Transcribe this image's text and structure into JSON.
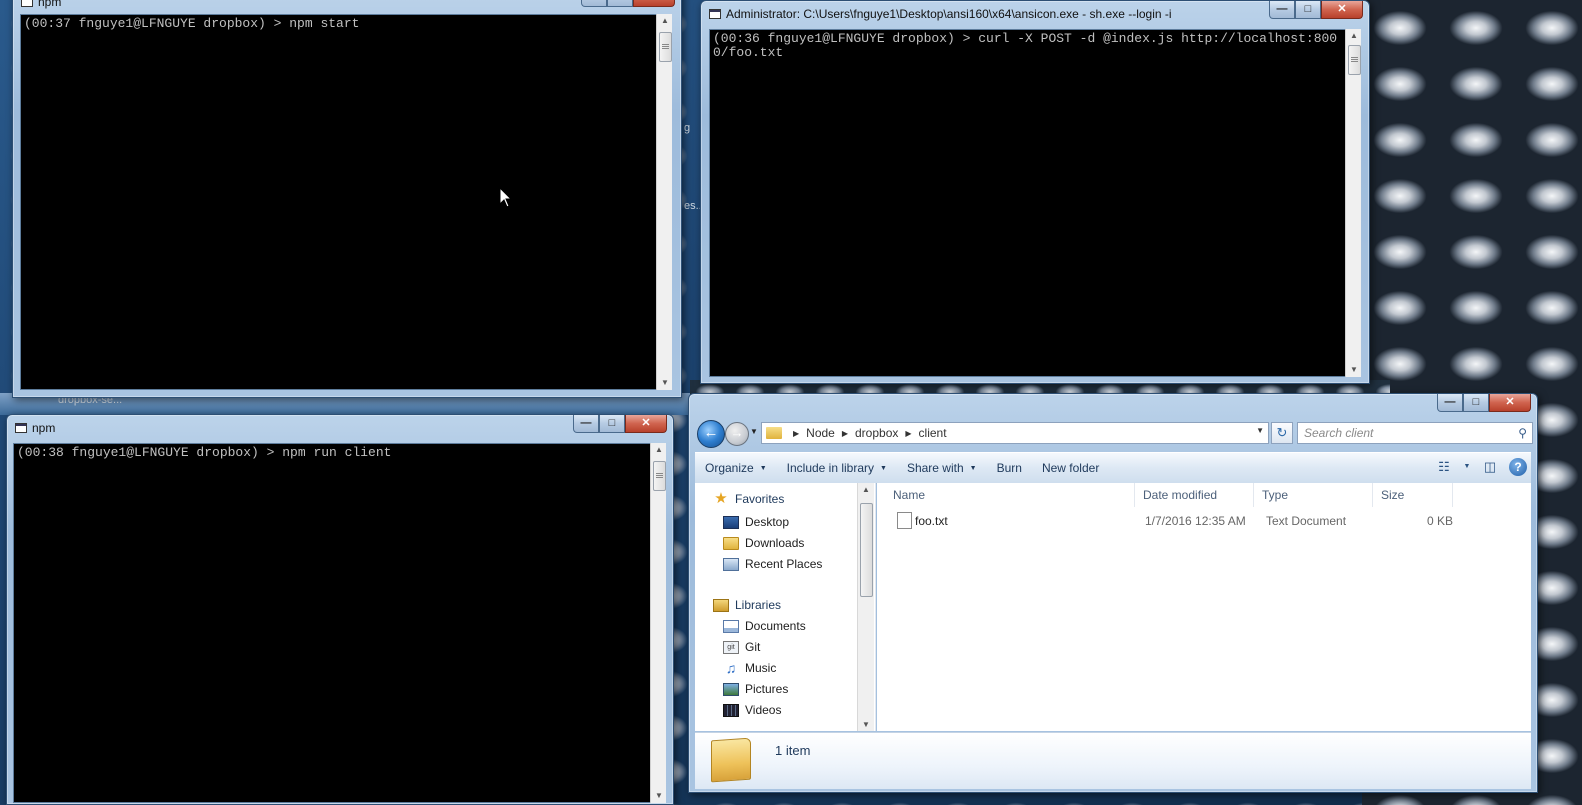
{
  "desktop": {
    "stray_labels": [
      "dropbox-se...",
      "g",
      "es.."
    ]
  },
  "win_npm_server": {
    "title": "npm",
    "console_text": "(00:37 fnguye1@LFNGUYE dropbox) > npm start"
  },
  "win_admin": {
    "title": "Administrator: C:\\Users\\fnguye1\\Desktop\\ansi160\\x64\\ansicon.exe - sh.exe  --login -i",
    "console_text": "(00:36 fnguye1@LFNGUYE dropbox) > curl -X POST -d @index.js http://localhost:8000/foo.txt"
  },
  "win_npm_client": {
    "title": "npm",
    "console_text": "(00:38 fnguye1@LFNGUYE dropbox) > npm run client"
  },
  "explorer": {
    "breadcrumb": [
      "Node",
      "dropbox",
      "client"
    ],
    "search_placeholder": "Search client",
    "toolbar": {
      "organize": "Organize",
      "include_in_library": "Include in library",
      "share_with": "Share with",
      "burn": "Burn",
      "new_folder": "New folder"
    },
    "nav": {
      "favorites": "Favorites",
      "favorites_items": [
        "Desktop",
        "Downloads",
        "Recent Places"
      ],
      "libraries": "Libraries",
      "libraries_items": [
        "Documents",
        "Git",
        "Music",
        "Pictures",
        "Videos"
      ]
    },
    "columns": {
      "name": "Name",
      "date_modified": "Date modified",
      "type": "Type",
      "size": "Size"
    },
    "files": [
      {
        "name": "foo.txt",
        "date_modified": "1/7/2016 12:35 AM",
        "type": "Text Document",
        "size": "0 KB"
      }
    ],
    "status": "1 item"
  }
}
